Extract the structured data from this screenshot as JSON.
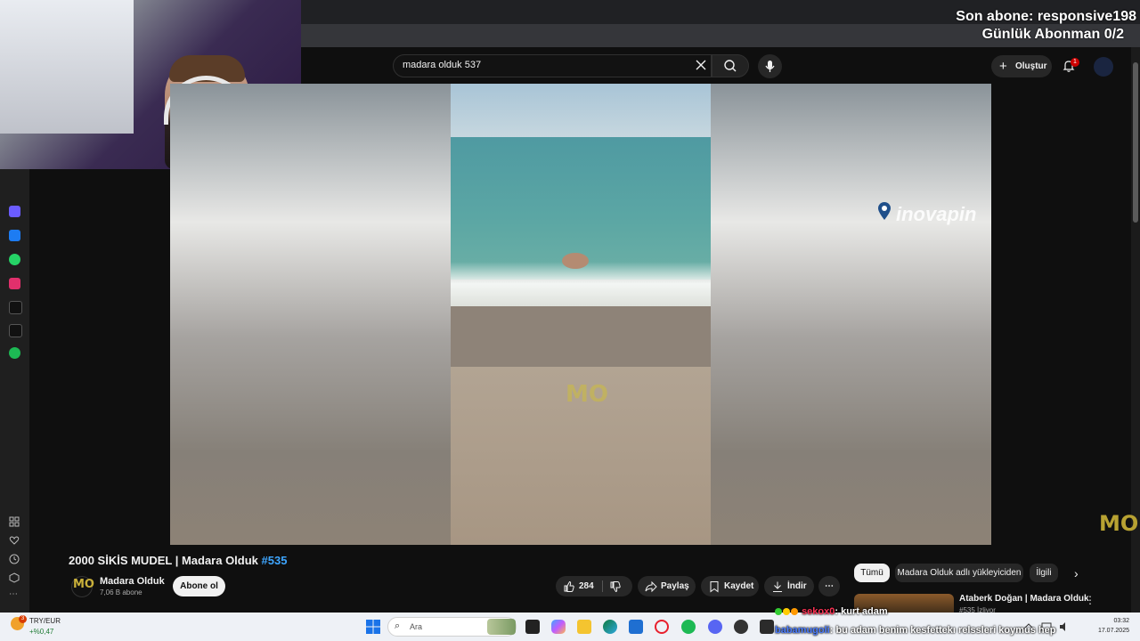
{
  "overlay": {
    "last_subscriber": "Son abone: responsive198",
    "daily_subscribers": "Günlük Abonman 0/2"
  },
  "youtube": {
    "search": {
      "query": "madara olduk 537"
    },
    "create_label": "Oluştur",
    "notification_count": "1",
    "video": {
      "title": "2000 SİKİS MUDEL | Madara Olduk ",
      "title_tag": "#535",
      "watermark": "inovapin",
      "logo": "MO"
    },
    "channel": {
      "name": "Madara Olduk",
      "subscribers": "7,06 B abone",
      "subscribe_label": "Abone ol"
    },
    "actions": {
      "likes": "284",
      "share": "Paylaş",
      "save": "Kaydet",
      "download": "İndir"
    },
    "chips": [
      "Tümü",
      "Madara Olduk adlı yükleyiciden",
      "İlgili"
    ],
    "recommended": {
      "title": "Ataberk Doğan | Madara Olduk",
      "subtitle": "#535 İzliyor"
    }
  },
  "chat": [
    {
      "user": "sekox0",
      "message": ": kurt adam"
    },
    {
      "user": "babamugoli",
      "message": ": bu adam benim kesfettekı relssleri koymus hep"
    }
  ],
  "taskbar": {
    "ticker_label": "TRY/EUR",
    "ticker_value": "+%0,47",
    "weather_badge": "3",
    "search_placeholder": "Ara",
    "time": "03:32",
    "date": "17.07.2025"
  },
  "colors": {
    "accent_link": "#3ea6ff",
    "background": "#0f0f0f",
    "notification_red": "#cc0000"
  }
}
